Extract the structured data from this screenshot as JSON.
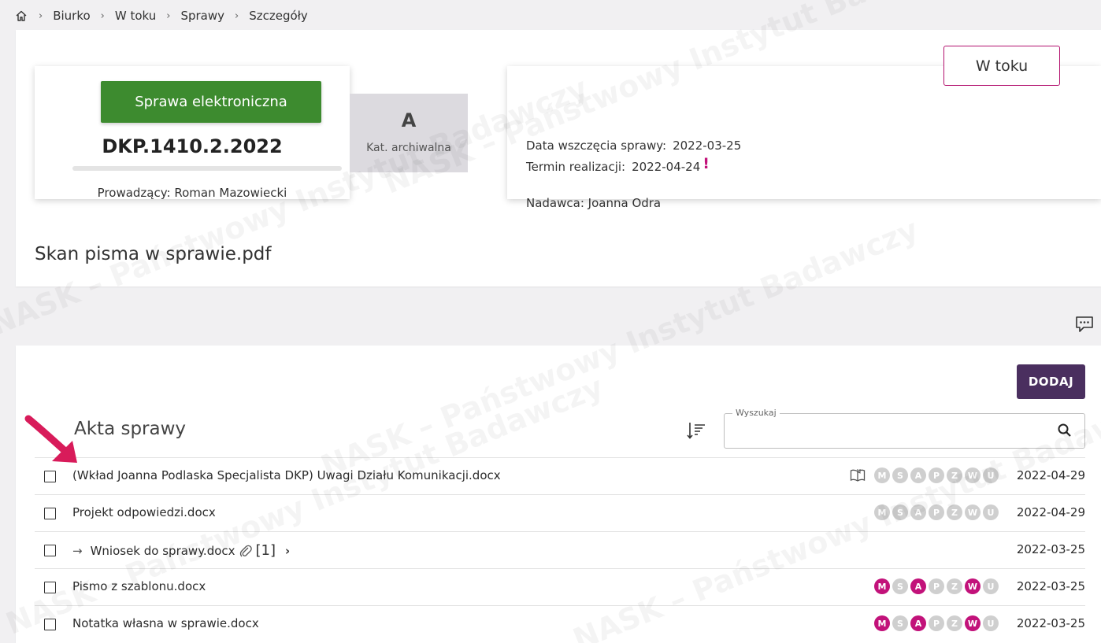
{
  "breadcrumb": {
    "home_icon": "home-icon",
    "items": [
      "Biurko",
      "W toku",
      "Sprawy",
      "Szczegóły"
    ]
  },
  "case": {
    "type_label": "Sprawa elektroniczna",
    "sign": "DKP.1410.2.2022",
    "owner_label": "Prowadzący:",
    "owner_name": "Roman Mazowiecki",
    "category_letter": "A",
    "category_label": "Kat. archiwalna",
    "status": "W toku",
    "start_label": "Data wszczęcia sprawy:",
    "start_date": "2022-03-25",
    "deadline_label": "Termin realizacji:",
    "deadline_date": "2022-04-24",
    "deadline_warning": "!",
    "sender_label": "Nadawca:",
    "sender_name": "Joanna Odra",
    "file_title": "Skan pisma w sprawie.pdf"
  },
  "files": {
    "add_label": "DODAJ",
    "section_title": "Akta sprawy",
    "search_label": "Wyszukaj",
    "search_value": "",
    "badge_letters": [
      "M",
      "S",
      "A",
      "P",
      "Z",
      "W",
      "U"
    ],
    "rows": [
      {
        "name": "(Wkład Joanna Podlaska Specjalista DKP) Uwagi Działu Komunikacji.docx",
        "date": "2022-04-29",
        "badges_on": [
          true,
          false,
          false,
          false,
          false,
          false,
          false
        ],
        "book": true,
        "show_badges": true
      },
      {
        "name": "Projekt odpowiedzi.docx",
        "date": "2022-04-29",
        "badges_on": [
          false,
          false,
          false,
          false,
          false,
          false,
          false
        ],
        "book": false,
        "show_badges": true
      },
      {
        "name": "Wniosek do sprawy.docx",
        "date": "2022-03-25",
        "attachments": "[1]",
        "sub_arrow": "→",
        "chevron": "›",
        "show_badges": false
      },
      {
        "name": "Pismo z szablonu.docx",
        "date": "2022-03-25",
        "badges_on": [
          true,
          false,
          true,
          false,
          false,
          true,
          false
        ],
        "book": false,
        "show_badges": true
      },
      {
        "name": "Notatka własna w sprawie.docx",
        "date": "2022-03-25",
        "badges_on": [
          true,
          false,
          true,
          false,
          false,
          true,
          false
        ],
        "book": false,
        "show_badges": true
      }
    ]
  },
  "colors": {
    "accent_green": "#3d8b2f",
    "accent_magenta": "#c2127a",
    "accent_purple": "#4a2f5f",
    "annotation_arrow": "#d81b5a"
  }
}
